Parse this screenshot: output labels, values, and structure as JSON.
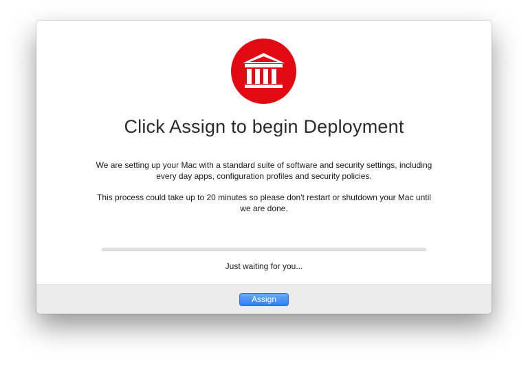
{
  "dialog": {
    "logo_icon": "bank-building-icon",
    "brand_color": "#e10a12",
    "title": "Click Assign to begin Deployment",
    "description_line1": "We are setting up your Mac with a standard suite of software and security settings, including every day apps, configuration profiles and security policies.",
    "description_line2": "This process could take up to 20 minutes so please don't restart or shutdown your Mac until we are done.",
    "progress_fraction": 0,
    "status_text": "Just waiting for you..."
  },
  "footer": {
    "assign_label": "Assign",
    "accent_color": "#3b86f7"
  }
}
